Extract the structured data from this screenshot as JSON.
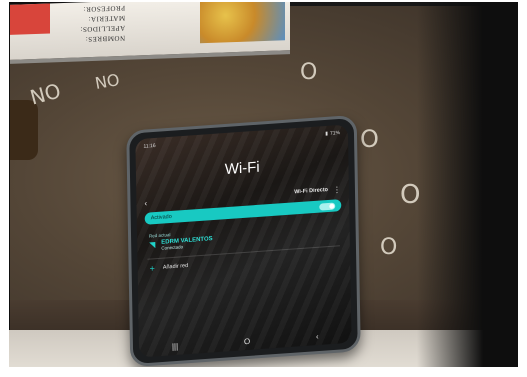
{
  "background": {
    "notebook_text": [
      "NOMBRES:",
      "APELLIDOS:",
      "MATERIA:",
      "PROFESOR:"
    ],
    "chalk_marks": [
      "NO",
      "O",
      "O",
      "O",
      "NO",
      "O"
    ]
  },
  "phone": {
    "status_bar": {
      "time": "11:16",
      "battery": "71%"
    },
    "title": "Wi-Fi",
    "toolbar": {
      "back_icon": "‹",
      "wifi_direct_label": "Wi-Fi Directo",
      "more_icon": "⋮"
    },
    "toggle": {
      "label": "Activado",
      "state": "on"
    },
    "section_label": "Red actual",
    "current_network": {
      "name": "EDRM VALENTOS",
      "status": "Conectado",
      "icon": "wifi-icon"
    },
    "add_network_label": "Añadir red",
    "nav_bar": {
      "recents": "|||",
      "home": "O",
      "back": "‹"
    }
  },
  "colors": {
    "accent": "#18c9c2",
    "screen_bg": "#1a1715"
  }
}
